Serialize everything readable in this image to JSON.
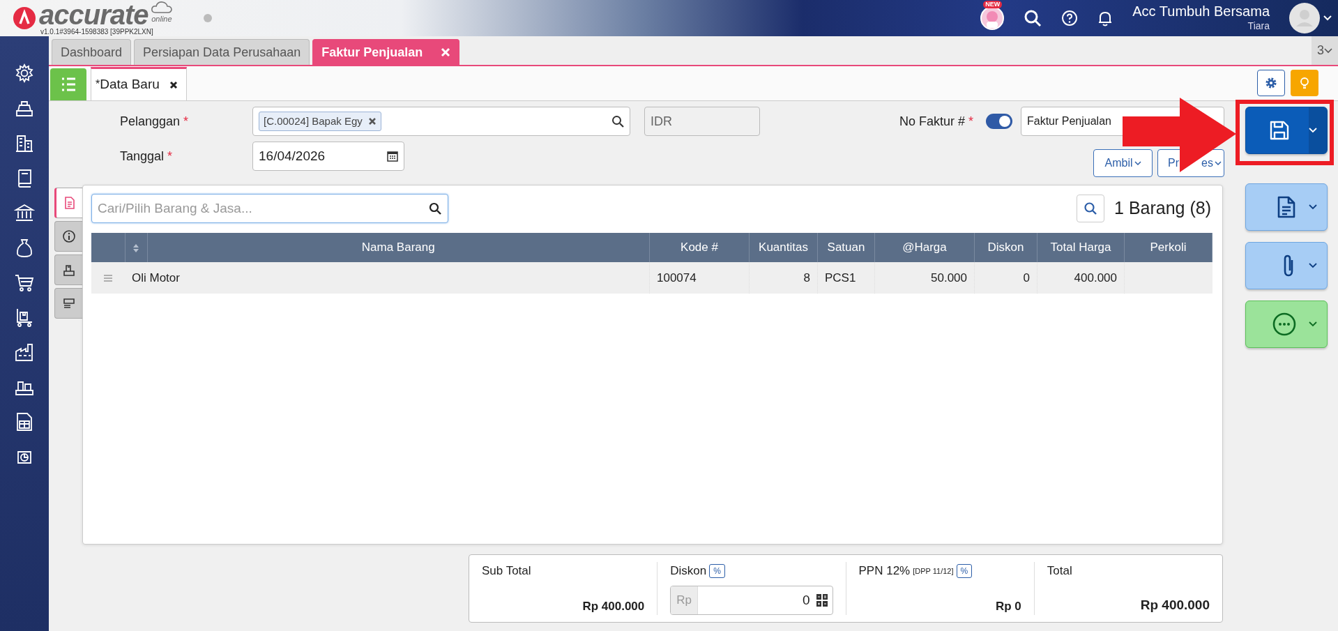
{
  "header": {
    "logo_text": "accurate",
    "logo_sub": "online",
    "version": "v1.0.1#3964-1598383 [39PPK2LXN]",
    "new_badge": "NEW",
    "company": "Acc Tumbuh Bersama",
    "user": "Tiara"
  },
  "tabs": [
    {
      "label": "Dashboard",
      "selected": false,
      "closable": false
    },
    {
      "label": "Persiapan Data Perusahaan",
      "selected": false,
      "closable": false
    },
    {
      "label": "Faktur Penjualan",
      "selected": true,
      "closable": true
    }
  ],
  "tab_count": "3",
  "subtabs": [
    {
      "marker": "*",
      "label": "Data Baru",
      "selected": true
    }
  ],
  "form": {
    "pelanggan": {
      "label": "Pelanggan",
      "required_mark": "*",
      "chip": "[C.00024] Bapak Egy"
    },
    "currency": "IDR",
    "no_faktur": {
      "label": "No Faktur #",
      "required_mark": "*",
      "auto_on": true,
      "value": "Faktur Penjualan"
    },
    "tanggal": {
      "label": "Tanggal",
      "required_mark": "*",
      "value": "16/04/2026"
    },
    "ambil": "Ambil",
    "proses_visible_parts": [
      "Pr",
      "es"
    ]
  },
  "side_tabs": [
    {
      "selected": true
    },
    {
      "selected": false
    },
    {
      "selected": false
    },
    {
      "selected": false
    }
  ],
  "items": {
    "search_placeholder": "Cari/Pilih Barang & Jasa...",
    "count": "1 Barang (8)",
    "columns": [
      "Nama Barang",
      "Kode #",
      "Kuantitas",
      "Satuan",
      "@Harga",
      "Diskon",
      "Total Harga",
      "Perkoli"
    ],
    "rows": [
      {
        "cells": [
          "Oli Motor",
          "100074",
          "8",
          "PCS1",
          "50.000",
          "0",
          "400.000"
        ]
      }
    ]
  },
  "totals": {
    "sub_total": {
      "label": "Sub Total",
      "value": "Rp 400.000"
    },
    "diskon": {
      "label": "Diskon",
      "badge": "%",
      "prefix": "Rp",
      "value": "0"
    },
    "ppn": {
      "label": "PPN 12%",
      "note": "[DPP 11/12]",
      "badge": "%",
      "value": "Rp 0"
    },
    "total": {
      "label": "Total",
      "value": "Rp 400.000"
    }
  }
}
